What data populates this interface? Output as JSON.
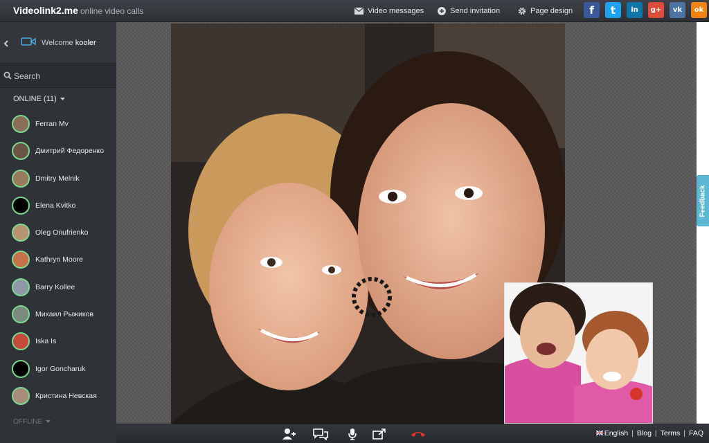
{
  "header": {
    "brand": "Videolink2.me",
    "tagline": "online video calls",
    "nav": {
      "video_messages": "Video messages",
      "send_invitation": "Send invitation",
      "page_design": "Page design"
    },
    "social": [
      {
        "name": "facebook-icon",
        "glyph": "f",
        "color": "#3b5998"
      },
      {
        "name": "twitter-icon",
        "glyph": "t",
        "color": "#1da1f2"
      },
      {
        "name": "linkedin-icon",
        "glyph": "in",
        "color": "#0e76a8"
      },
      {
        "name": "google-plus-icon",
        "glyph": "g+",
        "color": "#dd4b39"
      },
      {
        "name": "vk-icon",
        "glyph": "vk",
        "color": "#4c75a3"
      },
      {
        "name": "odnoklassniki-icon",
        "glyph": "ok",
        "color": "#f2820f"
      }
    ]
  },
  "sidebar": {
    "welcome_prefix": "Welcome",
    "username": "kooler",
    "search_label": "Search",
    "online_header": "ONLINE (11)",
    "offline_header": "OFFLINE",
    "contacts": [
      {
        "name": "Ferran Mv",
        "avatar_color": "#8a6e58"
      },
      {
        "name": "Дмитрий Федоренко",
        "avatar_color": "#6d5546"
      },
      {
        "name": "Dmitry Melnik",
        "avatar_color": "#9a7a5e"
      },
      {
        "name": "Elena Kvitko",
        "avatar_color": "#000000"
      },
      {
        "name": "Oleg Onufrienko",
        "avatar_color": "#b89473"
      },
      {
        "name": "Kathryn Moore",
        "avatar_color": "#c7704a"
      },
      {
        "name": "Barry Kollee",
        "avatar_color": "#8d98a8"
      },
      {
        "name": "Михаил Рыжиков",
        "avatar_color": "#7a8a7e"
      },
      {
        "name": "Iska Is",
        "avatar_color": "#c44a3c"
      },
      {
        "name": "Igor Goncharuk",
        "avatar_color": "#000000"
      },
      {
        "name": "Кристина Невская",
        "avatar_color": "#a78c7a"
      }
    ]
  },
  "video": {
    "feedback_label": "Feedback"
  },
  "footer": {
    "language": "English",
    "blog": "Blog",
    "terms": "Terms",
    "faq": "FAQ"
  }
}
